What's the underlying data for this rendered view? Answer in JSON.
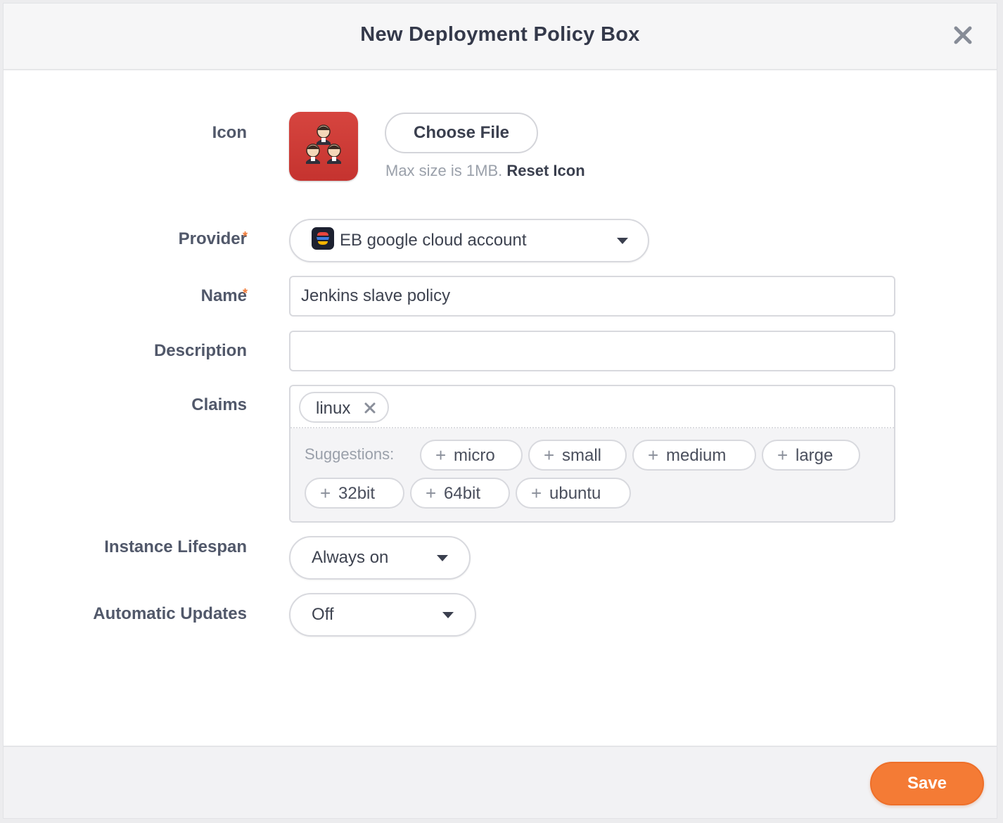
{
  "modal": {
    "title": "New Deployment Policy Box",
    "close_icon": "close-icon"
  },
  "form": {
    "icon": {
      "label": "Icon",
      "app_icon": "jenkins-icon",
      "choose_file_label": "Choose File",
      "hint": "Max size is 1MB.",
      "reset_label": "Reset Icon"
    },
    "provider": {
      "label": "Provider",
      "required_mark": "*",
      "value": "EB google cloud account",
      "icon": "google-cloud-icon"
    },
    "name": {
      "label": "Name",
      "required_mark": "*",
      "value": "Jenkins slave policy",
      "placeholder": ""
    },
    "description": {
      "label": "Description",
      "value": "",
      "placeholder": ""
    },
    "claims": {
      "label": "Claims",
      "tags": [
        "linux"
      ],
      "suggestions_label": "Suggestions:",
      "suggestions": [
        "micro",
        "small",
        "medium",
        "large",
        "32bit",
        "64bit",
        "ubuntu"
      ]
    },
    "instance_lifespan": {
      "label": "Instance Lifespan",
      "value": "Always on"
    },
    "automatic_updates": {
      "label": "Automatic Updates",
      "value": "Off"
    }
  },
  "footer": {
    "save_label": "Save"
  },
  "colors": {
    "accent": "#f47b35",
    "required": "#f07a37",
    "icon_bg": "#c9372f"
  }
}
